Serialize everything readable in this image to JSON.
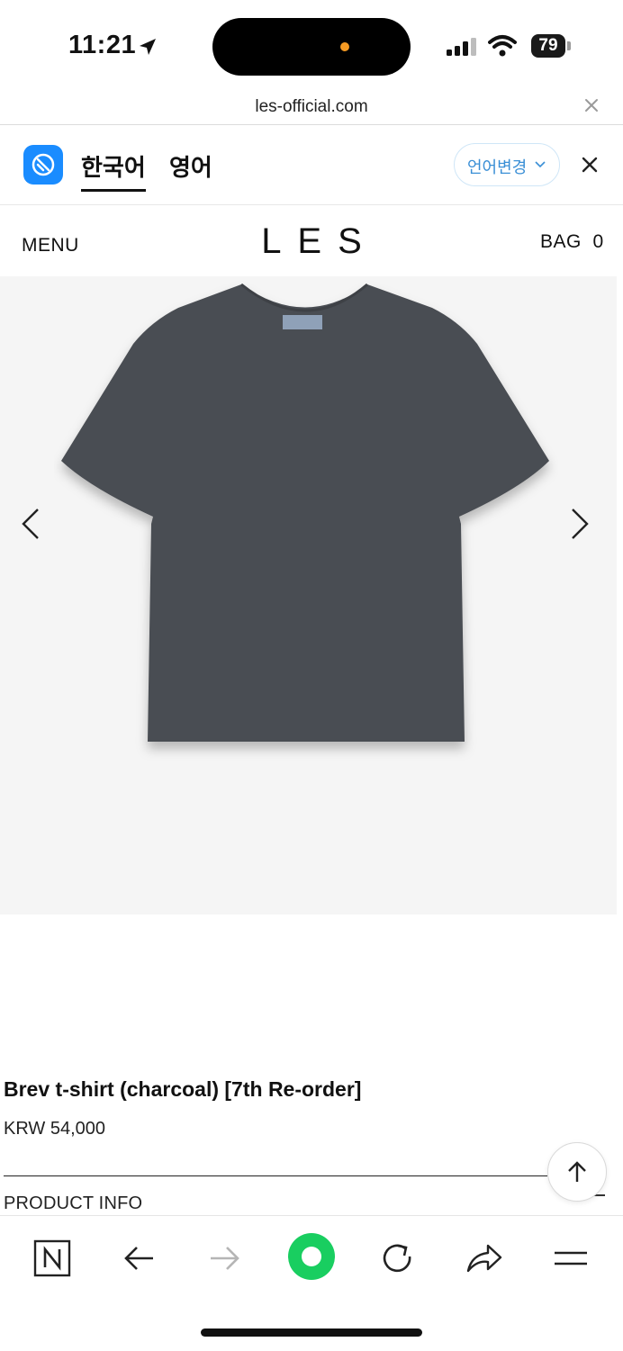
{
  "status_bar": {
    "time": "11:21",
    "battery": "79"
  },
  "browser": {
    "url": "les-official.com"
  },
  "translate_bar": {
    "source_lang": "한국어",
    "target_lang": "영어",
    "change_label": "언어변경",
    "accent_color": "#3a8fd6"
  },
  "site_header": {
    "menu_label": "MENU",
    "logo": "LES",
    "bag_label": "BAG  0"
  },
  "product": {
    "title": "Brev t-shirt (charcoal) [7th Re-order]",
    "price": "KRW 54,000",
    "info_label": "PRODUCT INFO",
    "info_toggle": "–",
    "image_color": "#4a4d52"
  },
  "toolbar": {
    "icons": [
      "naver-icon",
      "back-icon",
      "forward-icon",
      "green-dot-icon",
      "reload-icon",
      "share-icon",
      "menu-icon"
    ]
  }
}
